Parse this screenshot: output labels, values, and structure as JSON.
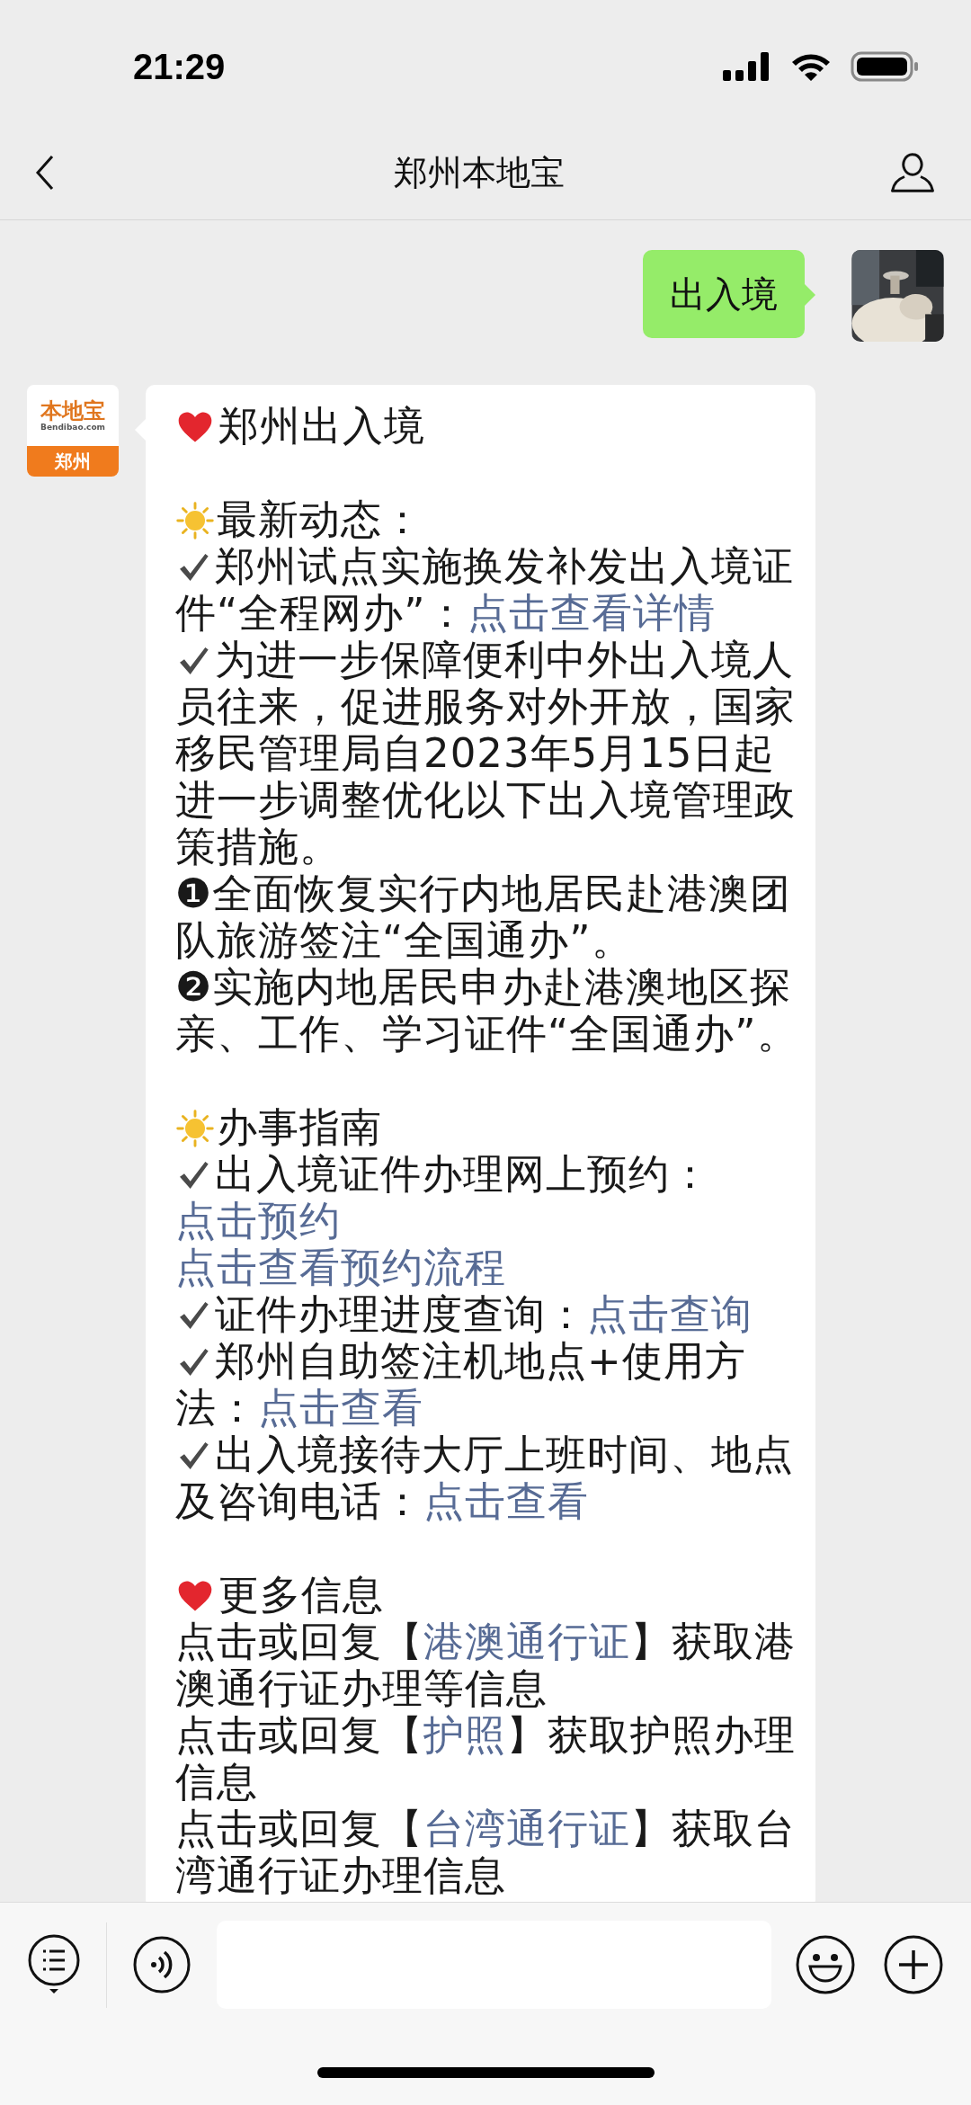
{
  "status_bar": {
    "time": "21:29"
  },
  "nav": {
    "title": "郑州本地宝"
  },
  "messages": [
    {
      "kind": "outgoing",
      "text": "出入境"
    },
    {
      "kind": "incoming",
      "logo": {
        "brand": "本地宝",
        "domain": "Bendibao.com",
        "city": "郑州"
      },
      "lines": [
        {
          "kind": "heart",
          "segments": [
            {
              "text": "郑州出入境",
              "link": false
            }
          ]
        },
        {
          "kind": "gap"
        },
        {
          "kind": "sun",
          "segments": [
            {
              "text": "最新动态：",
              "link": false
            }
          ]
        },
        {
          "kind": "check",
          "segments": [
            {
              "text": "郑州试点实施换发补发出入境证件“全程网办”：",
              "link": false
            },
            {
              "text": "点击查看详情",
              "link": true
            }
          ]
        },
        {
          "kind": "check",
          "segments": [
            {
              "text": "为进一步保障便利中外出入境人员往来，促进服务对外开放，国家移民管理局自2023年5月15日起进一步调整优化以下出入境管理政策措施。",
              "link": false
            }
          ]
        },
        {
          "kind": "text",
          "segments": [
            {
              "text": "❶全面恢复实行内地居民赴港澳团队旅游签注“全国通办”。",
              "link": false
            }
          ]
        },
        {
          "kind": "text",
          "segments": [
            {
              "text": "❷实施内地居民申办赴港澳地区探亲、工作、学习证件“全国通办”。",
              "link": false
            }
          ]
        },
        {
          "kind": "gap"
        },
        {
          "kind": "sun",
          "segments": [
            {
              "text": "办事指南",
              "link": false
            }
          ]
        },
        {
          "kind": "check",
          "segments": [
            {
              "text": "出入境证件办理网上预约：",
              "link": false
            },
            {
              "text": "点击预约",
              "link": true
            }
          ]
        },
        {
          "kind": "text",
          "segments": [
            {
              "text": "点击查看预约流程",
              "link": true
            }
          ]
        },
        {
          "kind": "check",
          "segments": [
            {
              "text": "证件办理进度查询：",
              "link": false
            },
            {
              "text": "点击查询",
              "link": true
            }
          ]
        },
        {
          "kind": "check",
          "segments": [
            {
              "text": "郑州自助签注机地点+使用方法：",
              "link": false
            },
            {
              "text": "点击查看",
              "link": true
            }
          ]
        },
        {
          "kind": "check",
          "segments": [
            {
              "text": "出入境接待大厅上班时间、地点及咨询电话：",
              "link": false
            },
            {
              "text": "点击查看",
              "link": true
            }
          ]
        },
        {
          "kind": "gap"
        },
        {
          "kind": "heart",
          "segments": [
            {
              "text": "更多信息",
              "link": false
            }
          ]
        },
        {
          "kind": "text",
          "segments": [
            {
              "text": "点击或回复【",
              "link": false
            },
            {
              "text": "港澳通行证",
              "link": true
            },
            {
              "text": "】获取港澳通行证办理等信息",
              "link": false
            }
          ]
        },
        {
          "kind": "text",
          "segments": [
            {
              "text": "点击或回复【",
              "link": false
            },
            {
              "text": "护照",
              "link": true
            },
            {
              "text": "】获取护照办理信息",
              "link": false
            }
          ]
        },
        {
          "kind": "text",
          "segments": [
            {
              "text": "点击或回复【",
              "link": false
            },
            {
              "text": "台湾通行证",
              "link": true
            },
            {
              "text": "】获取台湾通行证办理信息",
              "link": false
            }
          ]
        }
      ]
    }
  ]
}
